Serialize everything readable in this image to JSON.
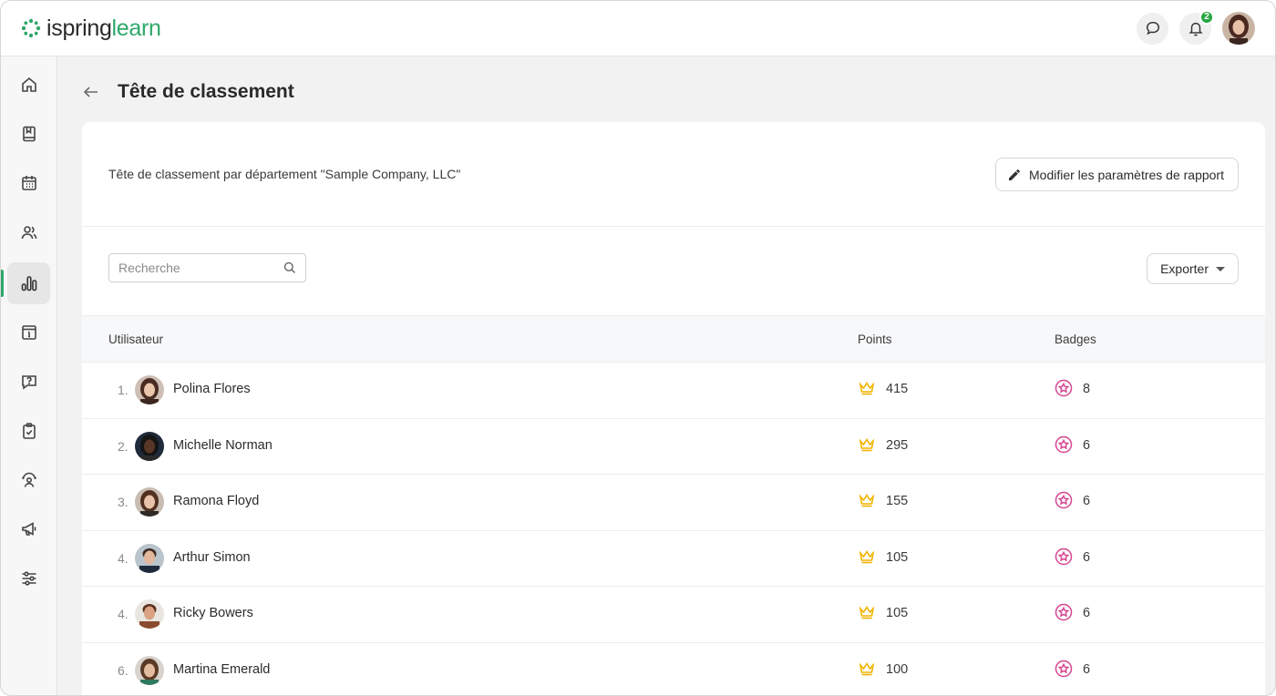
{
  "app": {
    "logo_part1": "ispring",
    "logo_part2": "learn",
    "notification_count": "2",
    "brand_color": "#2fa86a"
  },
  "sidebar": {
    "items": [
      {
        "icon": "home-icon"
      },
      {
        "icon": "book-icon"
      },
      {
        "icon": "calendar-icon"
      },
      {
        "icon": "users-icon"
      },
      {
        "icon": "reports-icon",
        "active": true
      },
      {
        "icon": "info-card-icon"
      },
      {
        "icon": "question-icon"
      },
      {
        "icon": "clipboard-check-icon"
      },
      {
        "icon": "user-circle-icon"
      },
      {
        "icon": "megaphone-icon"
      },
      {
        "icon": "sliders-icon"
      }
    ]
  },
  "page": {
    "title": "Tête de classement"
  },
  "report": {
    "description": "Tête de classement par département \"Sample Company, LLC\"",
    "edit_button": "Modifier les paramètres de rapport"
  },
  "search": {
    "placeholder": "Recherche"
  },
  "export": {
    "label": "Exporter"
  },
  "table": {
    "columns": {
      "user": "Utilisateur",
      "points": "Points",
      "badges": "Badges"
    },
    "rows": [
      {
        "rank": "1.",
        "name": "Polina Flores",
        "points": "415",
        "badges": "8"
      },
      {
        "rank": "2.",
        "name": "Michelle Norman",
        "points": "295",
        "badges": "6"
      },
      {
        "rank": "3.",
        "name": "Ramona Floyd",
        "points": "155",
        "badges": "6"
      },
      {
        "rank": "4.",
        "name": "Arthur Simon",
        "points": "105",
        "badges": "6"
      },
      {
        "rank": "4.",
        "name": "Ricky Bowers",
        "points": "105",
        "badges": "6"
      },
      {
        "rank": "6.",
        "name": "Martina Emerald",
        "points": "100",
        "badges": "6"
      }
    ]
  }
}
